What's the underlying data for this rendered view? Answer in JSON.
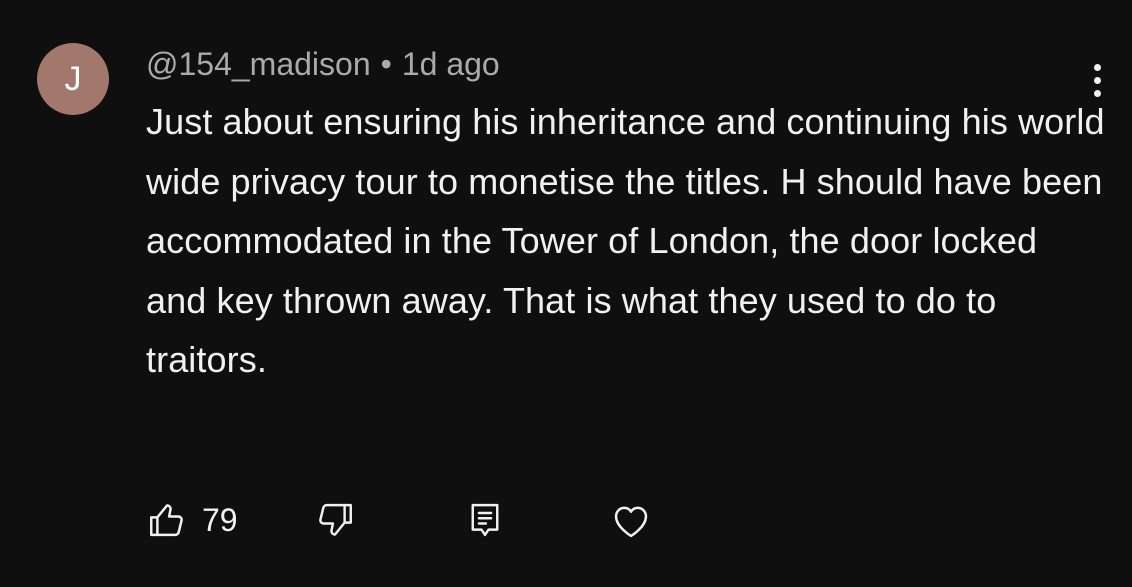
{
  "comment": {
    "avatar_letter": "J",
    "avatar_color": "#a1786b",
    "author": "@154_madison",
    "separator": "•",
    "time": "1d ago",
    "text": "Just about ensuring his inheritance and continuing his world wide privacy tour to monetise the titles. H should have been accommodated in the Tower of London, the door locked and key thrown away. That is what they used to do to traitors.",
    "like_count": "79"
  },
  "icons": {
    "more": "more-vertical-icon",
    "like": "thumbs-up-icon",
    "dislike": "thumbs-down-icon",
    "reply": "reply-comment-icon",
    "heart": "heart-icon"
  },
  "colors": {
    "background": "#0f0f0f",
    "text_primary": "#f1f1f1",
    "text_secondary": "#aaaaaa"
  }
}
